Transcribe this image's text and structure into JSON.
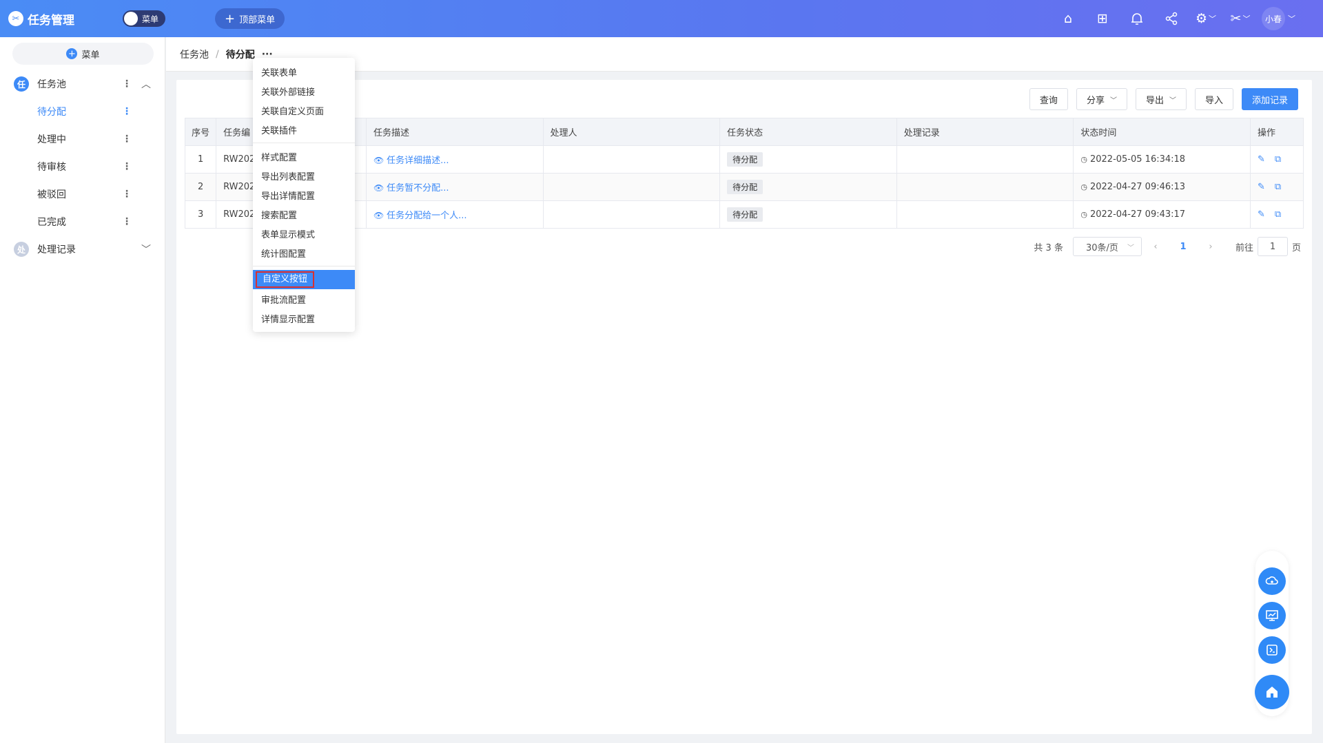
{
  "app": {
    "logo_glyph": "✂",
    "title": "任务管理",
    "menu_toggle_label": "菜单",
    "top_menu_button": "顶部菜单"
  },
  "topbar_icons": [
    {
      "name": "home-icon",
      "glyph": "⌂"
    },
    {
      "name": "apps-icon",
      "glyph": "⊞"
    },
    {
      "name": "bell-icon",
      "glyph": "🔔"
    },
    {
      "name": "share-icon",
      "glyph": "⋖"
    },
    {
      "name": "settings-icon",
      "glyph": "⚙"
    },
    {
      "name": "tools-icon",
      "glyph": "✂"
    }
  ],
  "user": {
    "name": "小春"
  },
  "sidebar": {
    "add_label": "菜单",
    "groups": [
      {
        "badge": "任",
        "label": "任务池"
      },
      {
        "badge": "处",
        "label": "处理记录"
      }
    ],
    "items": [
      {
        "label": "待分配"
      },
      {
        "label": "处理中"
      },
      {
        "label": "待审核"
      },
      {
        "label": "被驳回"
      },
      {
        "label": "已完成"
      }
    ]
  },
  "breadcrumb": {
    "root": "任务池",
    "separator": "/",
    "current": "待分配",
    "more": "···"
  },
  "toolbar": {
    "query": "查询",
    "share": "分享",
    "export": "导出",
    "import": "导入",
    "add": "添加记录"
  },
  "table": {
    "headers": [
      "序号",
      "任务编",
      "",
      "任务描述",
      "处理人",
      "任务状态",
      "处理记录",
      "状态时间",
      "操作"
    ],
    "rows": [
      {
        "index": "1",
        "code": "RW202",
        "desc": "任务详细描述...",
        "handler": "",
        "status": "待分配",
        "record": "",
        "time": "2022-05-05 16:34:18"
      },
      {
        "index": "2",
        "code": "RW202",
        "desc": "任务暂不分配...",
        "handler": "",
        "status": "待分配",
        "record": "",
        "time": "2022-04-27 09:46:13"
      },
      {
        "index": "3",
        "code": "RW202",
        "desc": "任务分配给一个人...",
        "handler": "",
        "status": "待分配",
        "record": "",
        "time": "2022-04-27 09:43:17"
      }
    ]
  },
  "pager": {
    "total": "共 3 条",
    "page_size": "30条/页",
    "page": "1",
    "goto": "前往",
    "goto_value": "1",
    "page_unit": "页"
  },
  "dropdown": {
    "group1": [
      "关联表单",
      "关联外部链接",
      "关联自定义页面",
      "关联插件"
    ],
    "group2": [
      "样式配置",
      "导出列表配置",
      "导出详情配置",
      "搜索配置",
      "表单显示模式",
      "统计图配置"
    ],
    "group3": [
      "自定义按钮",
      "审批流配置",
      "详情显示配置"
    ],
    "highlighted": "自定义按钮"
  },
  "float_buttons": [
    "cloud-gear-icon",
    "monitor-chart-icon",
    "terminal-icon",
    "house-icon"
  ],
  "colors": {
    "primary": "#3d8af7",
    "topbar_start": "#4a8cf5",
    "highlight_border": "#d93030"
  }
}
